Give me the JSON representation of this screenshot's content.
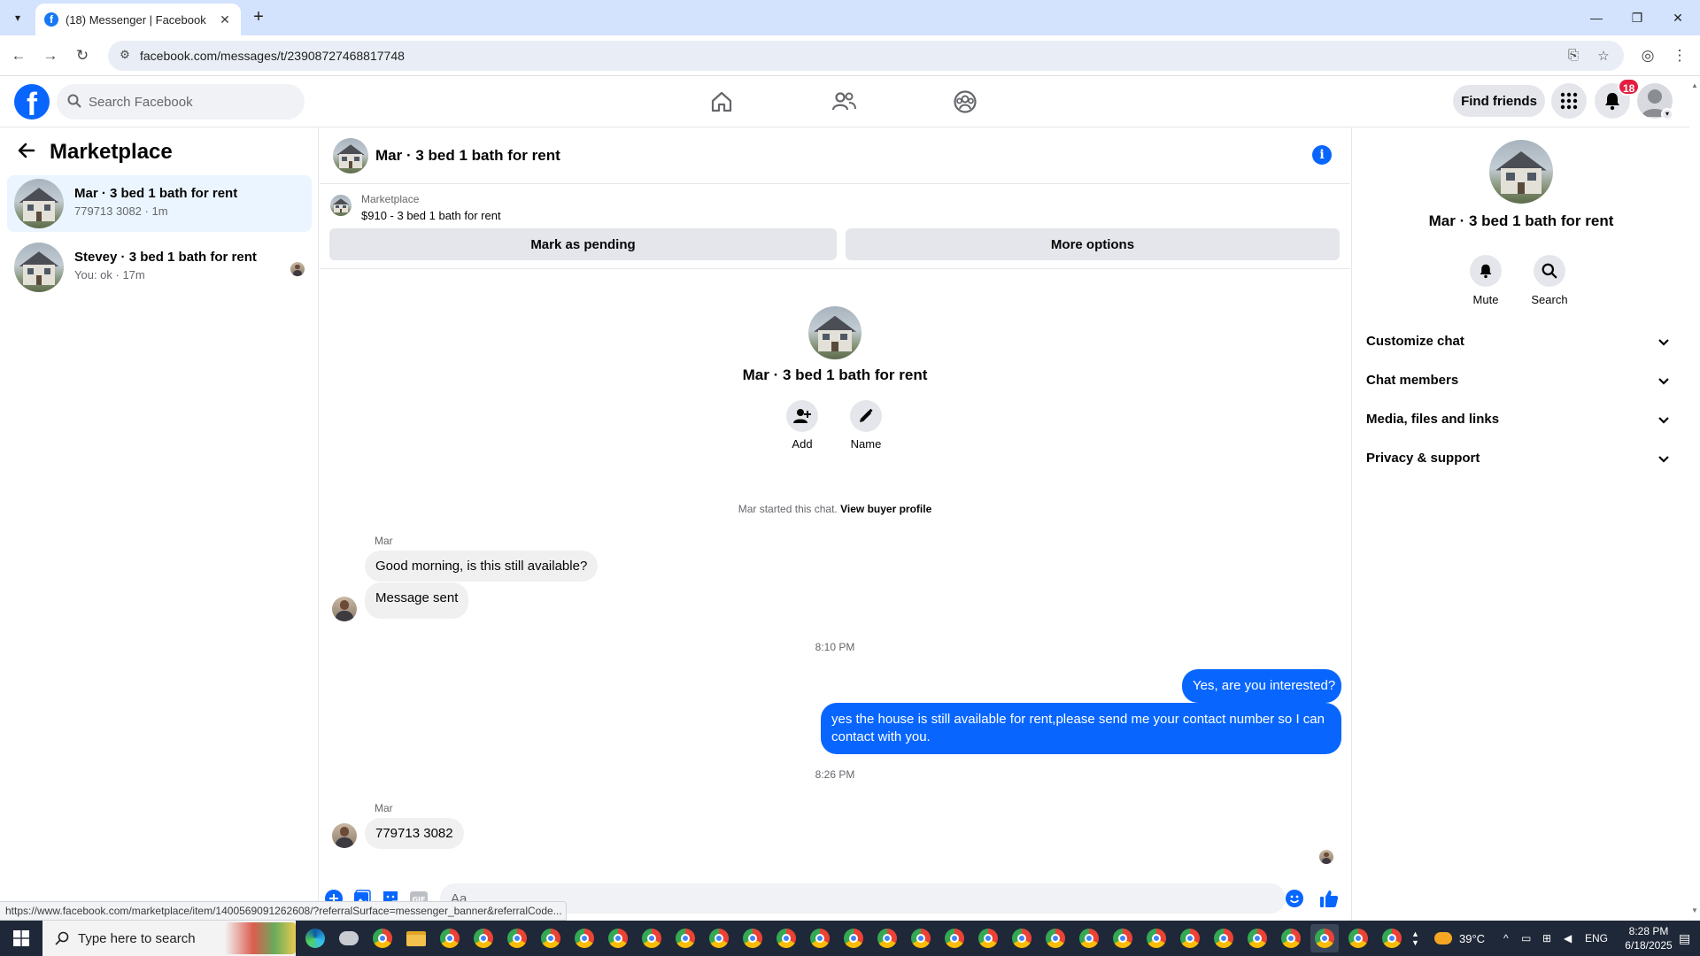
{
  "browser": {
    "tab_title": "(18) Messenger | Facebook",
    "url": "facebook.com/messages/t/23908727468817748",
    "status_url": "https://www.facebook.com/marketplace/item/1400569091262608/?referralSurface=messenger_banner&referralCode..."
  },
  "header": {
    "search_placeholder": "Search Facebook",
    "find_friends": "Find friends",
    "notification_count": "18"
  },
  "left_panel": {
    "title": "Marketplace",
    "conversations": [
      {
        "name": "Mar · 3 bed 1 bath for rent",
        "subtitle": "779713 3082 · 1m"
      },
      {
        "name": "Stevey · 3 bed 1 bath for rent",
        "subtitle": "You: ok · 17m"
      }
    ]
  },
  "conversation": {
    "title": "Mar · 3 bed 1 bath for rent",
    "banner": {
      "label": "Marketplace",
      "listing": "$910 - 3 bed 1 bath for rent",
      "mark_pending": "Mark as pending",
      "more_options": "More options"
    },
    "intro": {
      "name": "Mar · 3 bed 1 bath for rent",
      "add_label": "Add",
      "name_label": "Name",
      "started_text": "Mar started this chat.",
      "buyer_profile_link": "View buyer profile"
    },
    "messages": {
      "sender_1": "Mar",
      "msg_1": "Good morning, is this still available?",
      "msg_2": "Message sent",
      "time_1": "8:10 PM",
      "out_1": "Yes, are you interested?",
      "out_2": "yes the house is still available for rent,please send me your contact number so I can contact with you.",
      "time_2": "8:26 PM",
      "sender_2": "Mar",
      "msg_3": "779713 3082"
    },
    "composer_placeholder": "Aa"
  },
  "right_panel": {
    "name": "Mar · 3 bed 1 bath for rent",
    "mute_label": "Mute",
    "search_label": "Search",
    "sections": [
      "Customize chat",
      "Chat members",
      "Media, files and links",
      "Privacy & support"
    ]
  },
  "taskbar": {
    "search_placeholder": "Type here to search",
    "weather": "39°C",
    "language": "ENG",
    "time": "8:28 PM",
    "date": "6/18/2025"
  },
  "colors": {
    "accent": "#0866ff",
    "badge": "#e41e3f",
    "active_conv": "#ebf5ff"
  }
}
